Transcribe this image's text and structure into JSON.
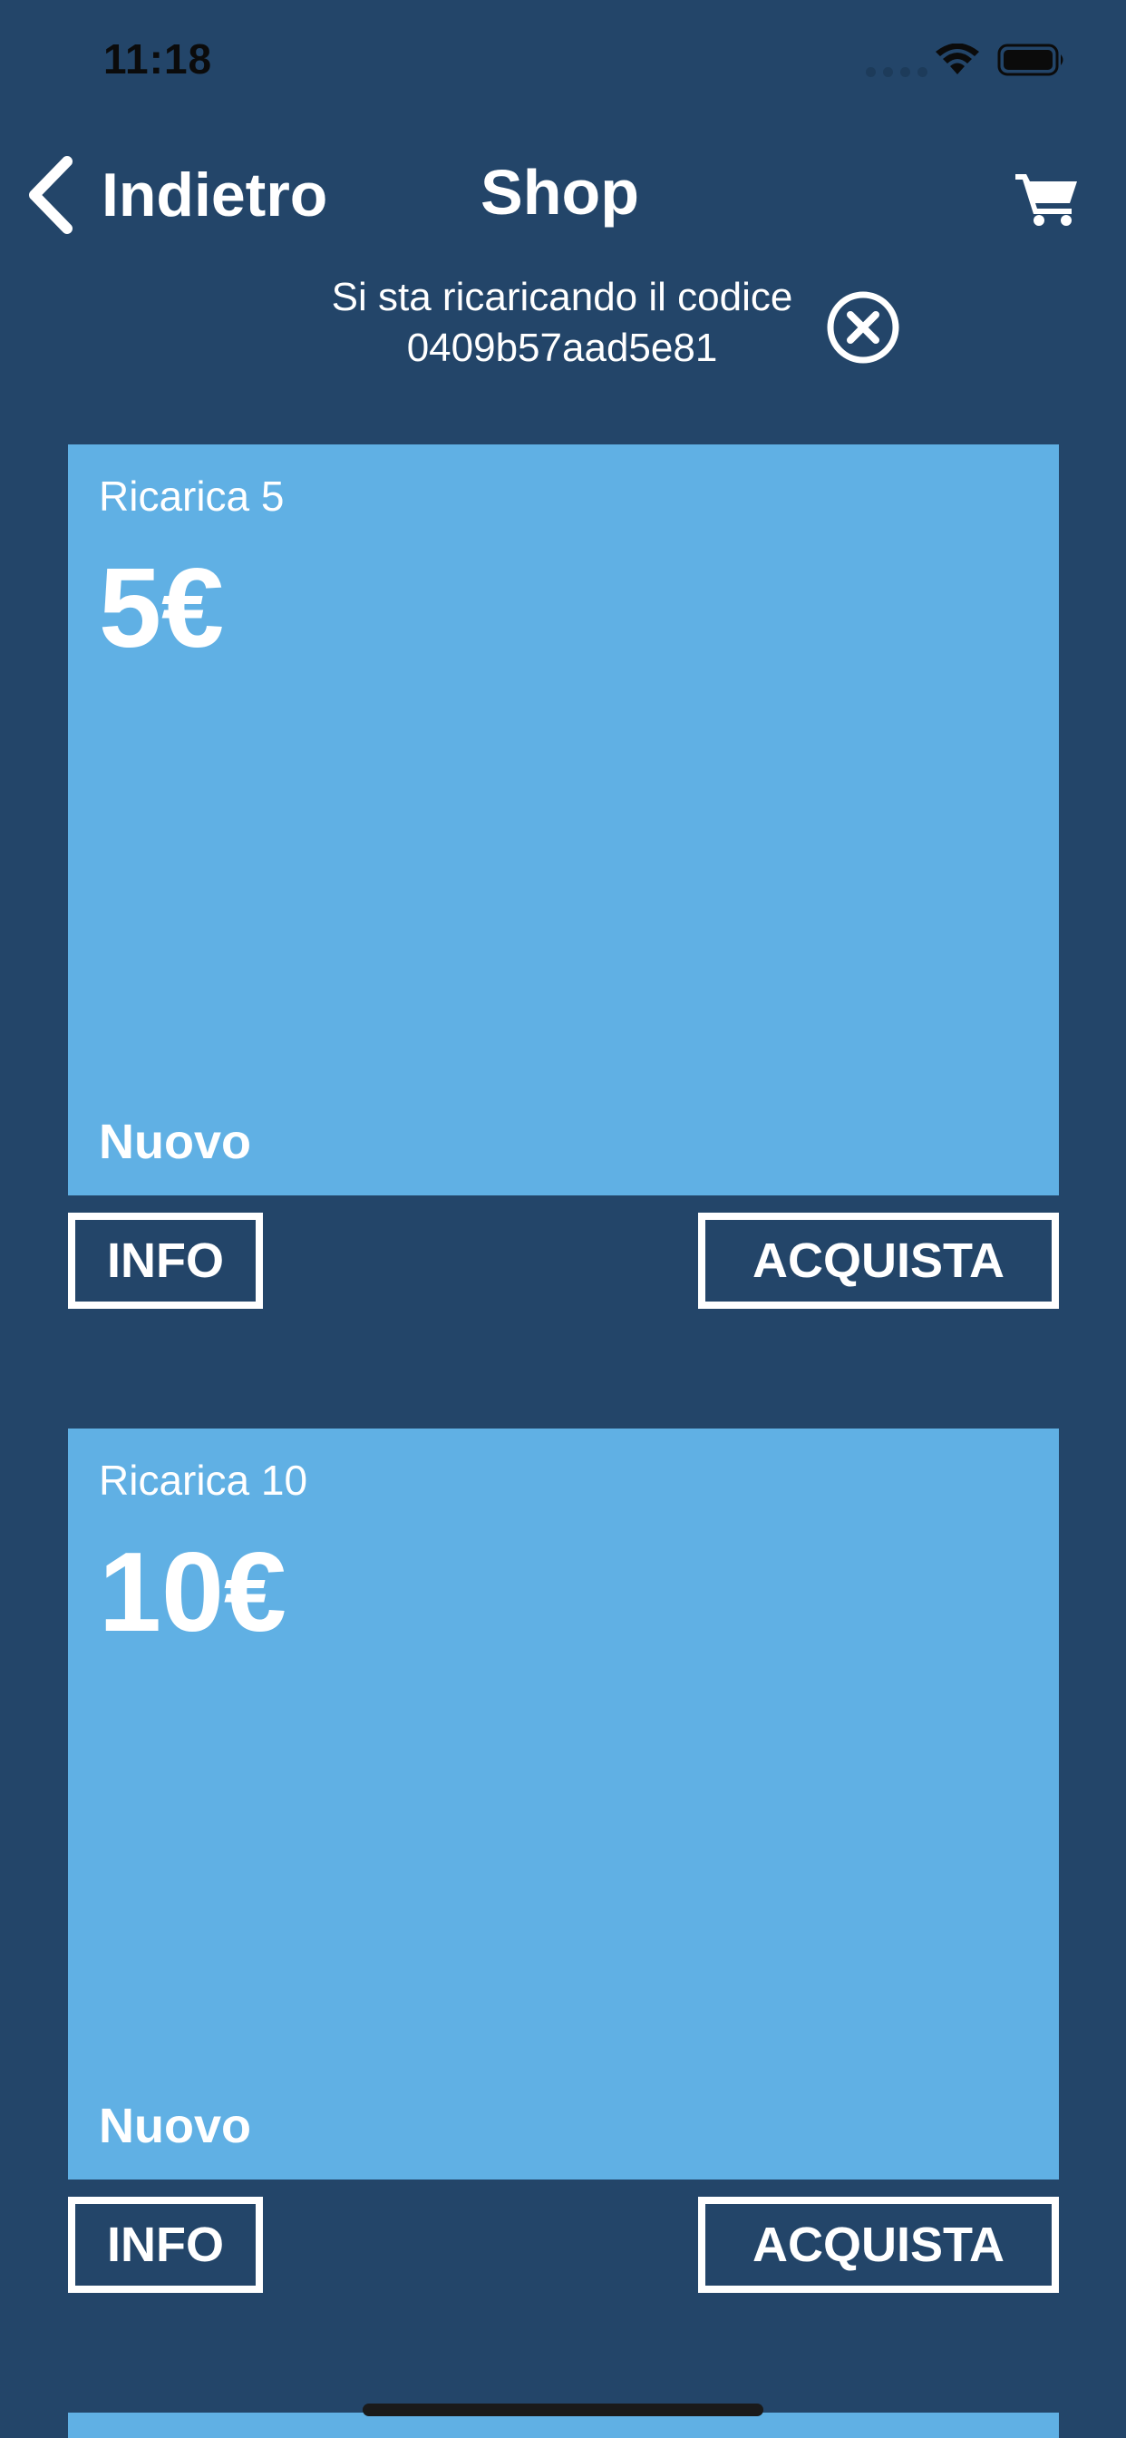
{
  "status_bar": {
    "time": "11:18"
  },
  "nav": {
    "back_label": "Indietro",
    "title": "Shop"
  },
  "notice": {
    "line1": "Si sta ricaricando il codice",
    "line2": "0409b57aad5e81"
  },
  "products": [
    {
      "name": "Ricarica 5",
      "price": "5€",
      "tag": "Nuovo",
      "info_label": "INFO",
      "buy_label": "ACQUISTA"
    },
    {
      "name": "Ricarica 10",
      "price": "10€",
      "tag": "Nuovo",
      "info_label": "INFO",
      "buy_label": "ACQUISTA"
    }
  ],
  "colors": {
    "background": "#234569",
    "card": "#60b0e4",
    "text": "#ffffff"
  },
  "icons": {
    "back": "chevron-left-icon",
    "cart": "cart-icon",
    "close": "close-circle-icon",
    "wifi": "wifi-icon",
    "battery": "battery-icon"
  }
}
